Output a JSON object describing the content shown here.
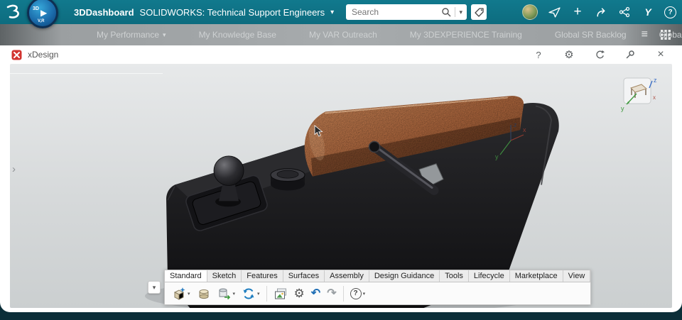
{
  "icons": {
    "play": "▶",
    "chevron_down": "▾",
    "overflow_chevron": "›",
    "hamburger": "≡",
    "plus": "+",
    "help": "?",
    "close": "×",
    "gear": "⚙",
    "undo": "↶",
    "redo": "↷",
    "panel_expand": "›",
    "collapse": "▾",
    "swym": "Y"
  },
  "topbar": {
    "brand": "3DDashboard",
    "context": "SOLIDWORKS: Technical Support Engineers",
    "search_placeholder": "Search",
    "compass": {
      "top": "3D",
      "bottom": "V,R"
    }
  },
  "nav": {
    "items": [
      {
        "label": "My Performance"
      },
      {
        "label": "My Knowledge Base"
      },
      {
        "label": "My VAR Outreach"
      },
      {
        "label": "My 3DEXPERIENCE Training"
      },
      {
        "label": "Global SR Backlog"
      },
      {
        "label": "Global SR"
      }
    ],
    "active": "My Performance"
  },
  "window": {
    "title": "xDesign"
  },
  "ribbon": {
    "tabs": [
      "Standard",
      "Sketch",
      "Features",
      "Surfaces",
      "Assembly",
      "Design Guidance",
      "Tools",
      "Lifecycle",
      "Marketplace",
      "View"
    ],
    "active_tab": "Standard"
  },
  "viewport": {
    "viewcube": {
      "x": "x",
      "y": "y",
      "z": "z"
    },
    "triad": {
      "x": "x",
      "y": "y",
      "z": "z"
    }
  },
  "colors": {
    "topbar_teal": "#0d6c7f",
    "copper": "#a9673c",
    "accent_blue": "#2d7fc1",
    "viewport_gray": "#d6d9da"
  }
}
